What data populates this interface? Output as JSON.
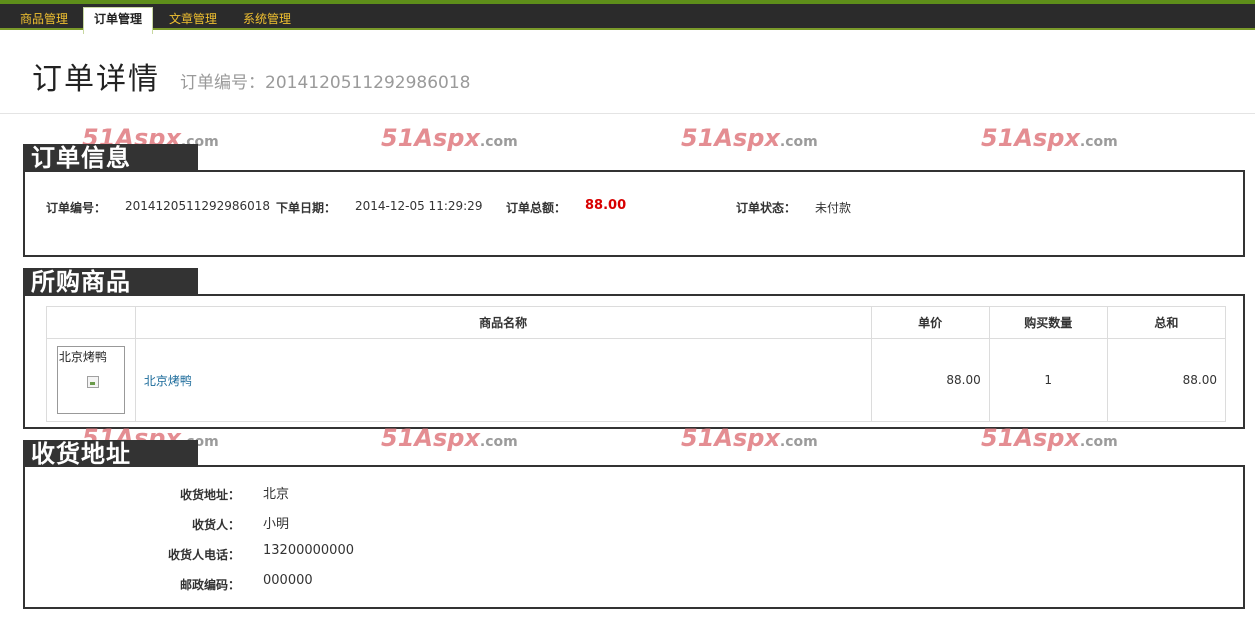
{
  "nav": {
    "tabs": [
      {
        "label": "商品管理"
      },
      {
        "label": "订单管理"
      },
      {
        "label": "文章管理"
      },
      {
        "label": "系统管理"
      }
    ],
    "active_index": 1
  },
  "header": {
    "title": "订单详情",
    "order_no_label": "订单编号：",
    "order_no": "201412051129298​6018"
  },
  "watermark": {
    "text": "51Aspx",
    "suffix": ".com"
  },
  "order_info": {
    "section_title": "订单信息",
    "order_no_label": "订单编号：",
    "order_no": "2014120511292986018",
    "date_label": "下单日期：",
    "date": "2014-12-05 11:29:29",
    "total_label": "订单总额：",
    "total": "88.00",
    "status_label": "订单状态：",
    "status": "未付款"
  },
  "products": {
    "section_title": "所购商品",
    "columns": [
      "",
      "商品名称",
      "单价",
      "购买数量",
      "总和"
    ],
    "rows": [
      {
        "image_alt": "北京烤鸭",
        "name": "北京烤鸭",
        "price": "88.00",
        "quantity": "1",
        "subtotal": "88.00"
      }
    ]
  },
  "shipping": {
    "section_title": "收货地址",
    "fields": [
      {
        "label": "收货地址：",
        "value": "北京"
      },
      {
        "label": "收货人：",
        "value": "小明"
      },
      {
        "label": "收货人电话：",
        "value": "13200000000"
      },
      {
        "label": "邮政编码：",
        "value": "000000"
      }
    ]
  },
  "colors": {
    "accent_green": "#5e8e1a",
    "nav_text": "#f0c030",
    "total_red": "#d80000",
    "link": "#1a6a9a"
  }
}
